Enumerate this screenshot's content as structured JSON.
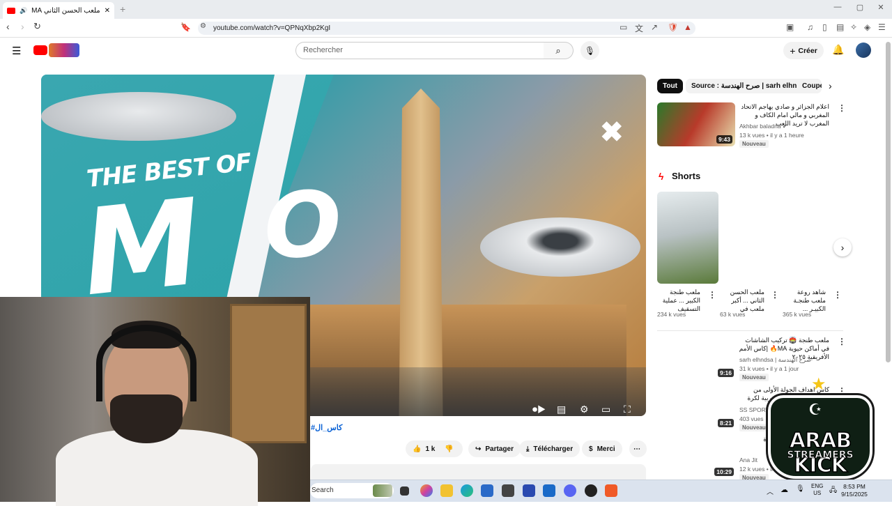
{
  "browser": {
    "tab_title": "ملعب الحسن الثاني MA ظهور",
    "new_tab": "+",
    "url": "youtube.com/watch?v=QPNqXbp2KgI",
    "window_controls": [
      "—",
      "▢",
      "✕"
    ]
  },
  "header": {
    "search_placeholder": "Rechercher",
    "create_label": "Créer"
  },
  "video": {
    "overlay_title": "THE BEST OF",
    "letter_m": "M",
    "letter_o": "O",
    "close_mark": "✖",
    "hashtag": "#كاس_ال"
  },
  "actions": {
    "like_count": "1 k",
    "share": "Partager",
    "download": "Télécharger",
    "thanks": "Merci"
  },
  "chips": [
    "Tout",
    "Source : صرح الهندسة | sarh elhndsa",
    "Coupe"
  ],
  "recommended": [
    {
      "title": "اعلام الجزائر و صادي يهاجم الاتحاد المغربي و مالي امام الكاف و المغرب لا تريد اللعب",
      "channel": "Akhbar baladna",
      "meta": "13 k vues • il y a 1 heure",
      "badge": "Nouveau",
      "duration": "9:43"
    },
    {
      "title": "ملعب طنجة 🏟️ تركيب الشاشات في أماكن حيوية MA🔥 |كاس الأمم الأفريقية ٢٠٢٥",
      "channel": "sarh elhndsa | صرح الهندسة",
      "meta": "31 k vues • il y a 1 jour",
      "badge": "Nouveau",
      "duration": "9:16"
    },
    {
      "title": "كاس اهداف الجولة الأولى من البطولة الإحترافية المغربية لكرة القدم",
      "channel": "SS SPORT",
      "meta": "403 vues",
      "badge": "Nouveau",
      "duration": "8:21"
    },
    {
      "title": "شمال شارع التدبق عمارة",
      "channel": "Ana Jit",
      "meta": "12 k vues • il y a",
      "badge": "Nouveau",
      "duration": "10:29"
    }
  ],
  "shorts": {
    "heading": "Shorts",
    "items": [
      {
        "title": "ملعب طنجة الكبير ... عملية التسقيف",
        "views": "234 k vues"
      },
      {
        "title": "ملعب الحسن الثاني ... أكبر ملعب في",
        "views": "63 k vues"
      },
      {
        "title": "شاهد روعة ملعب طنجـة الكبيـر ...",
        "views": "365 k vues"
      }
    ]
  },
  "taskbar": {
    "search": "Search",
    "lang": "ENG",
    "region": "US",
    "time": "8:53 PM",
    "date": "9/15/2025"
  },
  "logo": {
    "line1": "ARAB KICK",
    "line2": "STREAMERS"
  },
  "colors": {
    "youtube_red": "#ff0000",
    "link_blue": "#065fd4",
    "chip_active": "#0f0f0f"
  }
}
